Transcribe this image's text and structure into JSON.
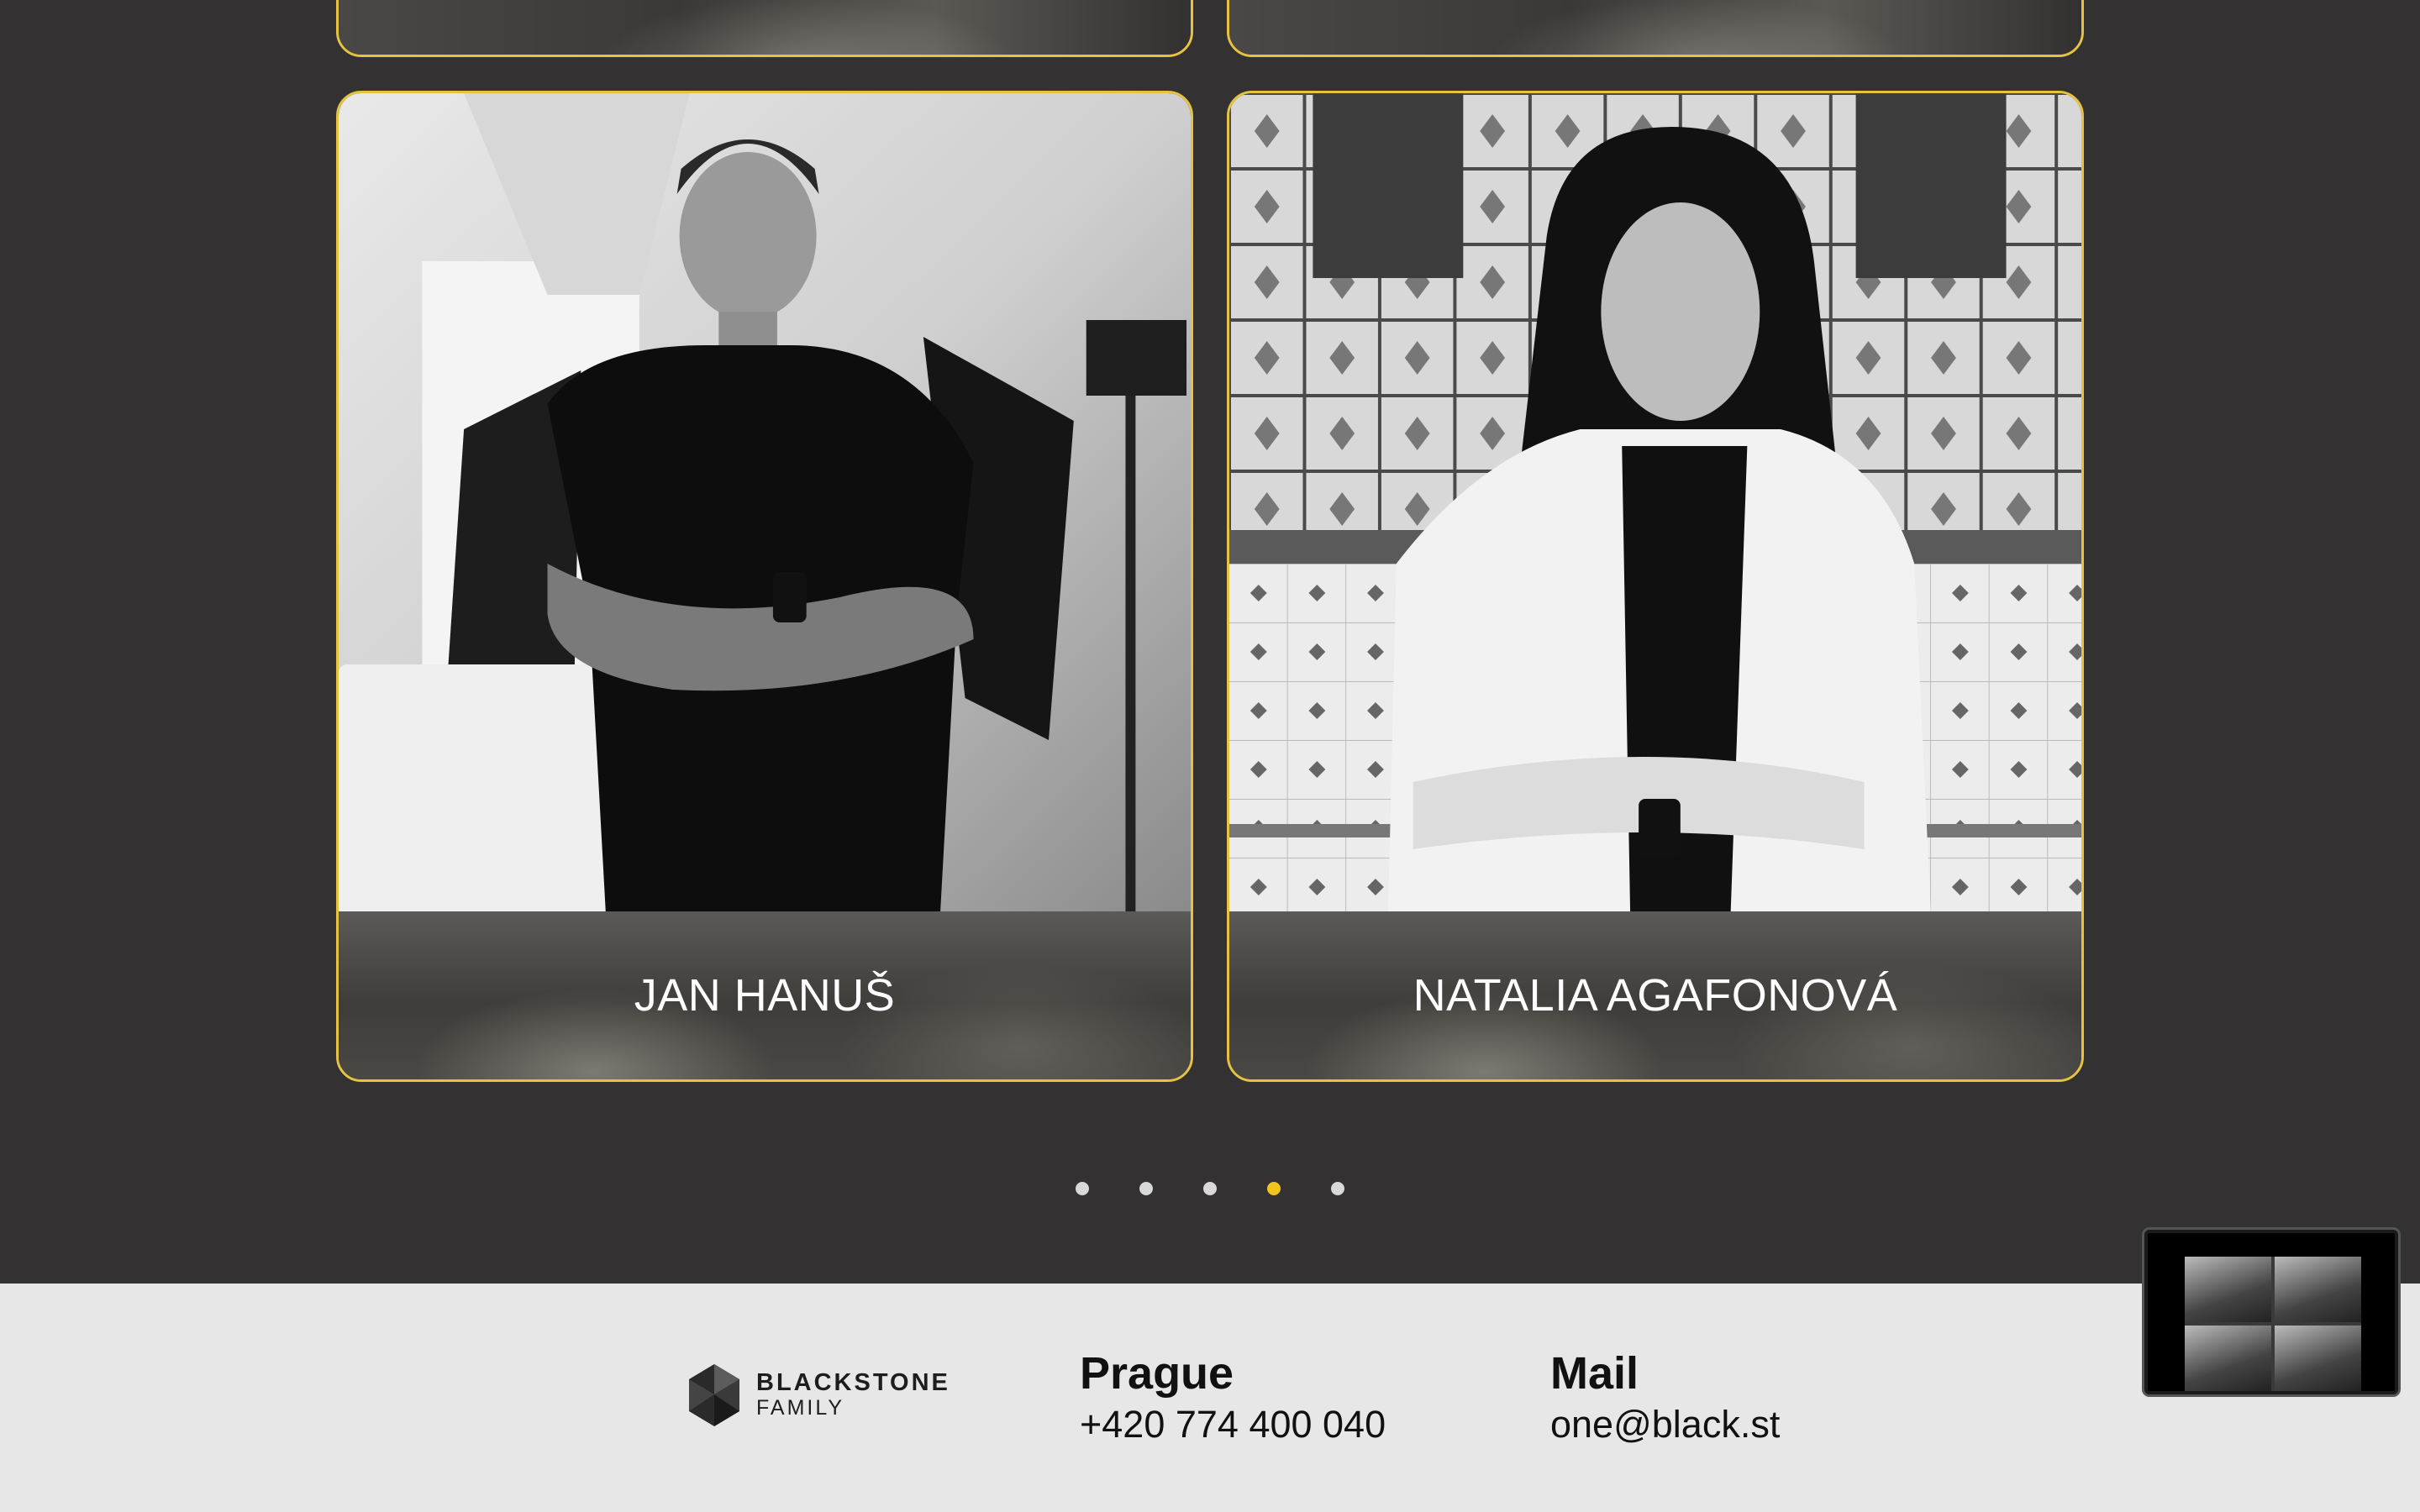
{
  "team": {
    "members": [
      {
        "name": "JAN HANUŠ"
      },
      {
        "name": "NATALIA AGAFONOVÁ"
      }
    ]
  },
  "carousel": {
    "total_pages": 5,
    "active_page": 4
  },
  "footer": {
    "logo_line1": "BLACKSTONE",
    "logo_line2": "FAMILY",
    "city_title": "Prague",
    "phone": "+420 774 400 040",
    "mail_title": "Mail",
    "email": "one@black.st"
  },
  "colors": {
    "background": "#333132",
    "accent_gold": "#e5c340",
    "footer_bg": "#e7e7e7"
  }
}
